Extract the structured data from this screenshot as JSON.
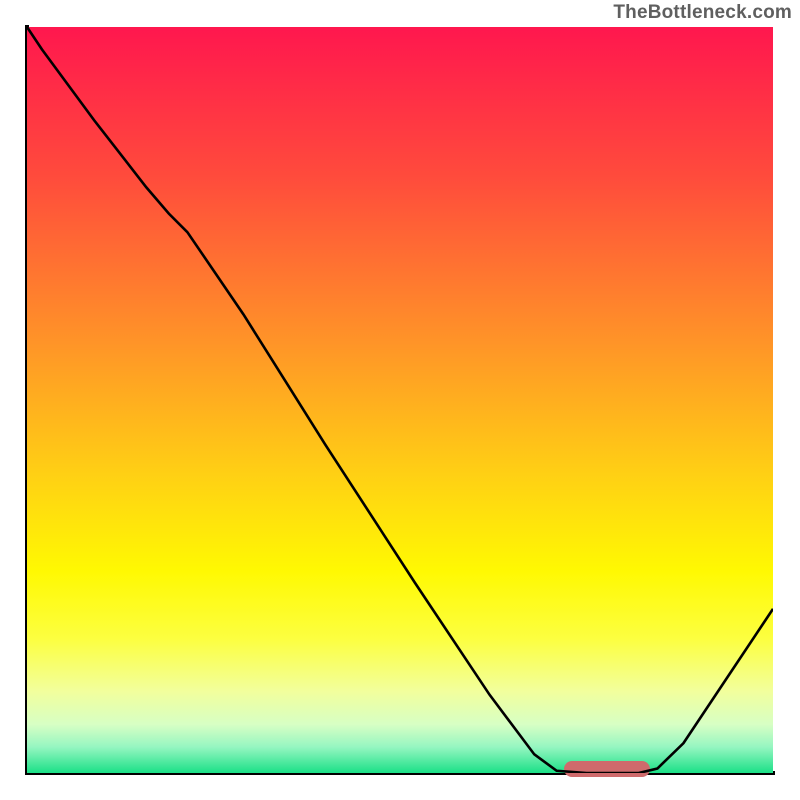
{
  "watermark": "TheBottleneck.com",
  "chart_data": {
    "type": "line",
    "title": "",
    "xlabel": "",
    "ylabel": "",
    "xlim": [
      0,
      100
    ],
    "ylim": [
      0,
      100
    ],
    "gradient_stops": [
      {
        "pos": 0.0,
        "color": "#ff174e"
      },
      {
        "pos": 0.2,
        "color": "#ff4b3c"
      },
      {
        "pos": 0.42,
        "color": "#ff9328"
      },
      {
        "pos": 0.6,
        "color": "#ffd014"
      },
      {
        "pos": 0.73,
        "color": "#fff902"
      },
      {
        "pos": 0.82,
        "color": "#fcff40"
      },
      {
        "pos": 0.89,
        "color": "#f2ff9c"
      },
      {
        "pos": 0.935,
        "color": "#d7ffc4"
      },
      {
        "pos": 0.965,
        "color": "#96f6c1"
      },
      {
        "pos": 1.0,
        "color": "#1be087"
      }
    ],
    "curve_points": [
      {
        "x": 0.0,
        "y": 100.0
      },
      {
        "x": 2.0,
        "y": 97.0
      },
      {
        "x": 9.0,
        "y": 87.5
      },
      {
        "x": 16.0,
        "y": 78.5
      },
      {
        "x": 19.0,
        "y": 75.0
      },
      {
        "x": 21.5,
        "y": 72.5
      },
      {
        "x": 29.0,
        "y": 61.5
      },
      {
        "x": 40.0,
        "y": 44.0
      },
      {
        "x": 52.0,
        "y": 25.5
      },
      {
        "x": 62.0,
        "y": 10.5
      },
      {
        "x": 68.0,
        "y": 2.5
      },
      {
        "x": 71.0,
        "y": 0.3
      },
      {
        "x": 75.0,
        "y": 0.0
      },
      {
        "x": 82.0,
        "y": 0.0
      },
      {
        "x": 84.5,
        "y": 0.6
      },
      {
        "x": 88.0,
        "y": 4.0
      },
      {
        "x": 94.0,
        "y": 13.0
      },
      {
        "x": 100.0,
        "y": 22.0
      }
    ],
    "optimal_marker": {
      "x_start": 72.0,
      "x_end": 83.5,
      "y": 0.0
    }
  }
}
